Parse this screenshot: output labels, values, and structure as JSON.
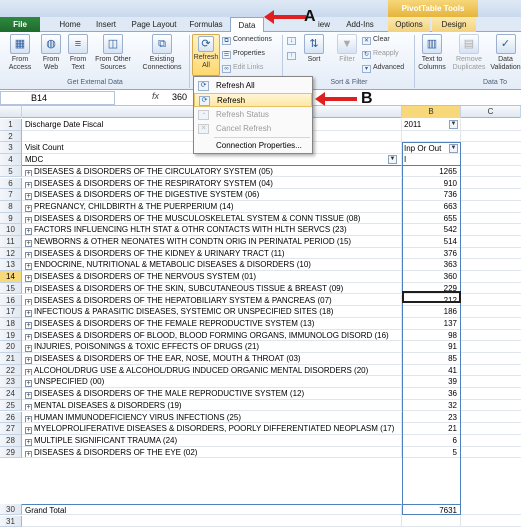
{
  "titlebar": {
    "pivot_tools": "PivotTable Tools"
  },
  "tabs": {
    "file": "File",
    "home": "Home",
    "insert": "Insert",
    "page_layout": "Page Layout",
    "formulas": "Formulas",
    "data": "Data",
    "review": "iew",
    "addins": "Add-Ins",
    "options": "Options",
    "design": "Design"
  },
  "ribbon": {
    "from_access": "From Access",
    "from_web": "From Web",
    "from_text": "From Text",
    "from_other_sources": "From Other Sources",
    "existing_connections": "Existing Connections",
    "refresh_all": "Refresh All",
    "connections": "Connections",
    "properties": "Properties",
    "edit_links": "Edit Links",
    "sort": "Sort",
    "filter": "Filter",
    "clear": "Clear",
    "reapply": "Reapply",
    "advanced": "Advanced",
    "text_to_columns": "Text to Columns",
    "remove_duplicates": "Remove Duplicates",
    "data_validation": "Data Validation",
    "group_get_external": "Get External Data",
    "group_sort_filter": "Sort & Filter",
    "group_data_tools": "Data To"
  },
  "formula_bar": {
    "cell": "B14",
    "fx": "fx",
    "value": "360"
  },
  "columns": {
    "a": "A",
    "b": "B",
    "c": "C"
  },
  "menu": {
    "refresh_all": "Refresh All",
    "refresh": "Refresh",
    "refresh_status": "Refresh Status",
    "cancel_refresh": "Cancel Refresh",
    "connection_properties": "Connection Properties..."
  },
  "annotations": {
    "a": "A",
    "b": "B"
  },
  "sheet": {
    "r1_label": "Discharge Date Fiscal",
    "r1_value": "2011",
    "r3_label": "Visit Count",
    "r3_value": "Inp Or Out",
    "r4_label": "MDC",
    "r4_value": "I",
    "rows": [
      {
        "n": "5",
        "label": "DISEASES & DISORDERS OF THE CIRCULATORY SYSTEM (05)",
        "value": "1265"
      },
      {
        "n": "6",
        "label": "DISEASES & DISORDERS OF THE RESPIRATORY SYSTEM (04)",
        "value": "910"
      },
      {
        "n": "7",
        "label": "DISEASES & DISORDERS OF THE DIGESTIVE SYSTEM (06)",
        "value": "736"
      },
      {
        "n": "8",
        "label": "PREGNANCY, CHILDBIRTH & THE PUERPERIUM (14)",
        "value": "663"
      },
      {
        "n": "9",
        "label": "DISEASES & DISORDERS OF THE MUSCULOSKELETAL SYSTEM & CONN TISSUE (08)",
        "value": "655"
      },
      {
        "n": "10",
        "label": "FACTORS INFLUENCING HLTH STAT & OTHR CONTACTS WITH HLTH SERVCS (23)",
        "value": "542"
      },
      {
        "n": "11",
        "label": "NEWBORNS & OTHER NEONATES WITH CONDTN ORIG IN PERINATAL PERIOD (15)",
        "value": "514"
      },
      {
        "n": "12",
        "label": "DISEASES & DISORDERS OF THE KIDNEY & URINARY TRACT (11)",
        "value": "376"
      },
      {
        "n": "13",
        "label": "ENDOCRINE, NUTRITIONAL & METABOLIC DISEASES & DISORDERS (10)",
        "value": "363"
      },
      {
        "n": "14",
        "label": "DISEASES & DISORDERS OF THE NERVOUS SYSTEM (01)",
        "value": "360"
      },
      {
        "n": "15",
        "label": "DISEASES & DISORDERS OF THE SKIN, SUBCUTANEOUS TISSUE & BREAST (09)",
        "value": "229"
      },
      {
        "n": "16",
        "label": "DISEASES & DISORDERS OF THE HEPATOBILIARY SYSTEM & PANCREAS (07)",
        "value": "212"
      },
      {
        "n": "17",
        "label": "INFECTIOUS & PARASITIC DISEASES, SYSTEMIC OR UNSPECIFIED SITES (18)",
        "value": "186"
      },
      {
        "n": "18",
        "label": "DISEASES & DISORDERS OF THE FEMALE REPRODUCTIVE SYSTEM (13)",
        "value": "137"
      },
      {
        "n": "19",
        "label": "DISEASES & DISORDERS OF BLOOD, BLOOD FORMING ORGANS, IMMUNOLOG DISORD (16)",
        "value": "98"
      },
      {
        "n": "20",
        "label": "INJURIES, POISONINGS & TOXIC EFFECTS OF DRUGS (21)",
        "value": "91"
      },
      {
        "n": "21",
        "label": "DISEASES & DISORDERS OF THE EAR, NOSE, MOUTH & THROAT (03)",
        "value": "85"
      },
      {
        "n": "22",
        "label": "ALCOHOL/DRUG USE & ALCOHOL/DRUG INDUCED ORGANIC MENTAL DISORDERS (20)",
        "value": "41"
      },
      {
        "n": "23",
        "label": "UNSPECIFIED (00)",
        "value": "39"
      },
      {
        "n": "24",
        "label": "DISEASES & DISORDERS OF THE MALE REPRODUCTIVE SYSTEM (12)",
        "value": "36"
      },
      {
        "n": "25",
        "label": "MENTAL DISEASES & DISORDERS (19)",
        "value": "32"
      },
      {
        "n": "26",
        "label": "HUMAN IMMUNODEFICIENCY VIRUS INFECTIONS (25)",
        "value": "23"
      },
      {
        "n": "27",
        "label": "MYELOPROLIFERATIVE DISEASES & DISORDERS, POORLY DIFFERENTIATED NEOPLASM (17)",
        "value": "21"
      },
      {
        "n": "28",
        "label": "MULTIPLE SIGNIFICANT TRAUMA (24)",
        "value": "6"
      },
      {
        "n": "29",
        "label": "DISEASES & DISORDERS OF THE EYE (02)",
        "value": "5"
      }
    ],
    "grand_total_label": "Grand Total",
    "grand_total_value": "7631"
  }
}
